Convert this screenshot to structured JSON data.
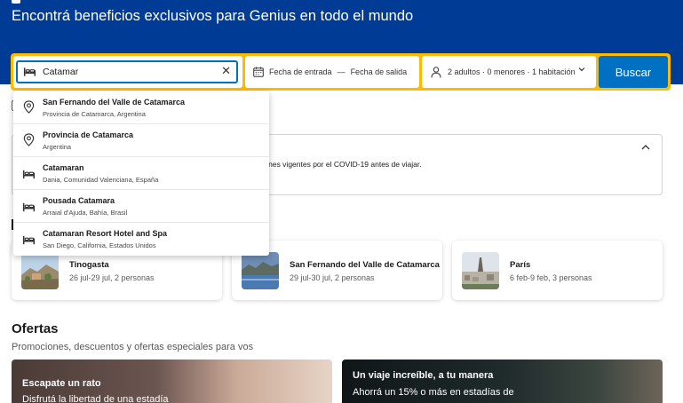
{
  "hero": {
    "subtitle": "Encontrá beneficios exclusivos para Genius en todo el mundo"
  },
  "search": {
    "destination_value": "Catamar",
    "clear_icon": "close-icon",
    "dates_checkin": "Fecha de entrada",
    "dates_separator": "—",
    "dates_checkout": "Fecha de salida",
    "guests": "2 adultos · 0 menores · 1 habitación",
    "button": "Buscar"
  },
  "autocomplete": [
    {
      "icon": "location-pin-icon",
      "title": "San Fernando del Valle de Catamarca",
      "subtitle": "Provincia de Catamarca, Argentina"
    },
    {
      "icon": "location-pin-icon",
      "title": "Provincia de Catamarca",
      "subtitle": "Argentina"
    },
    {
      "icon": "bed-icon",
      "title": "Catamaran",
      "subtitle": "Dania, Comunidad Valenciana, España"
    },
    {
      "icon": "bed-icon",
      "title": "Pousada Catamara",
      "subtitle": "Arraial d'Ajuda, Bahía, Brasil"
    },
    {
      "icon": "bed-icon",
      "title": "Catamaran Resort Hotel and Spa",
      "subtitle": "San Diego, California, Estados Unidos"
    }
  ],
  "notice": {
    "text": "cciones vigentes por el COVID-19 antes de viajar."
  },
  "recent_searches": [
    {
      "name": "Tinogasta",
      "meta": "26 jul-29 jul, 2 personas"
    },
    {
      "name": "San Fernando del Valle de Catamarca",
      "meta": "29 jul-30 jul, 2 personas"
    },
    {
      "name": "París",
      "meta": "6 feb-9 feb, 3 personas"
    }
  ],
  "ofertas": {
    "title": "Ofertas",
    "subtitle": "Promociones, descuentos y ofertas especiales para vos",
    "promos": [
      {
        "title": "Escapate un rato",
        "text": "Disfrutá la libertad de una estadía"
      },
      {
        "title": "Un viaje increíble, a tu manera",
        "text": "Ahorrá un 15% o más en estadías de"
      }
    ]
  },
  "colors": {
    "brand_blue": "#003b95",
    "accent_blue": "#0071c2",
    "search_yellow": "#febb02"
  }
}
